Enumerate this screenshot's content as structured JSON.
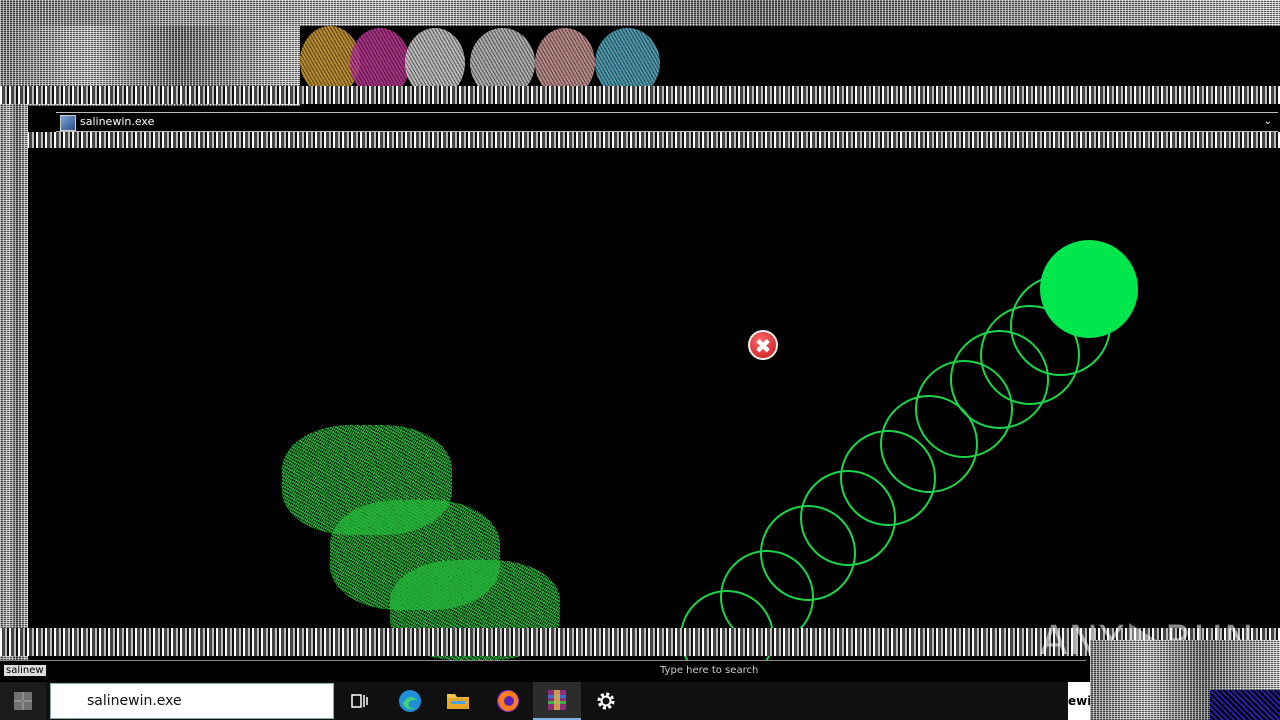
{
  "window": {
    "title": "salinewin.exe"
  },
  "watermark": {
    "left": "ANY",
    "right": "RUN"
  },
  "hint_bar": {
    "left_text": "salinew",
    "tooltip": "Type here to search"
  },
  "taskbar": {
    "search": {
      "value": "salinewin.exe"
    },
    "tray_text": "ewi",
    "apps": [
      {
        "name": "task-view"
      },
      {
        "name": "edge"
      },
      {
        "name": "file-explorer"
      },
      {
        "name": "firefox"
      },
      {
        "name": "winrar"
      },
      {
        "name": "settings"
      }
    ]
  },
  "colors": {
    "green": "#00e64d",
    "ring_green": "#19d64a",
    "error_red": "#c4161c"
  }
}
